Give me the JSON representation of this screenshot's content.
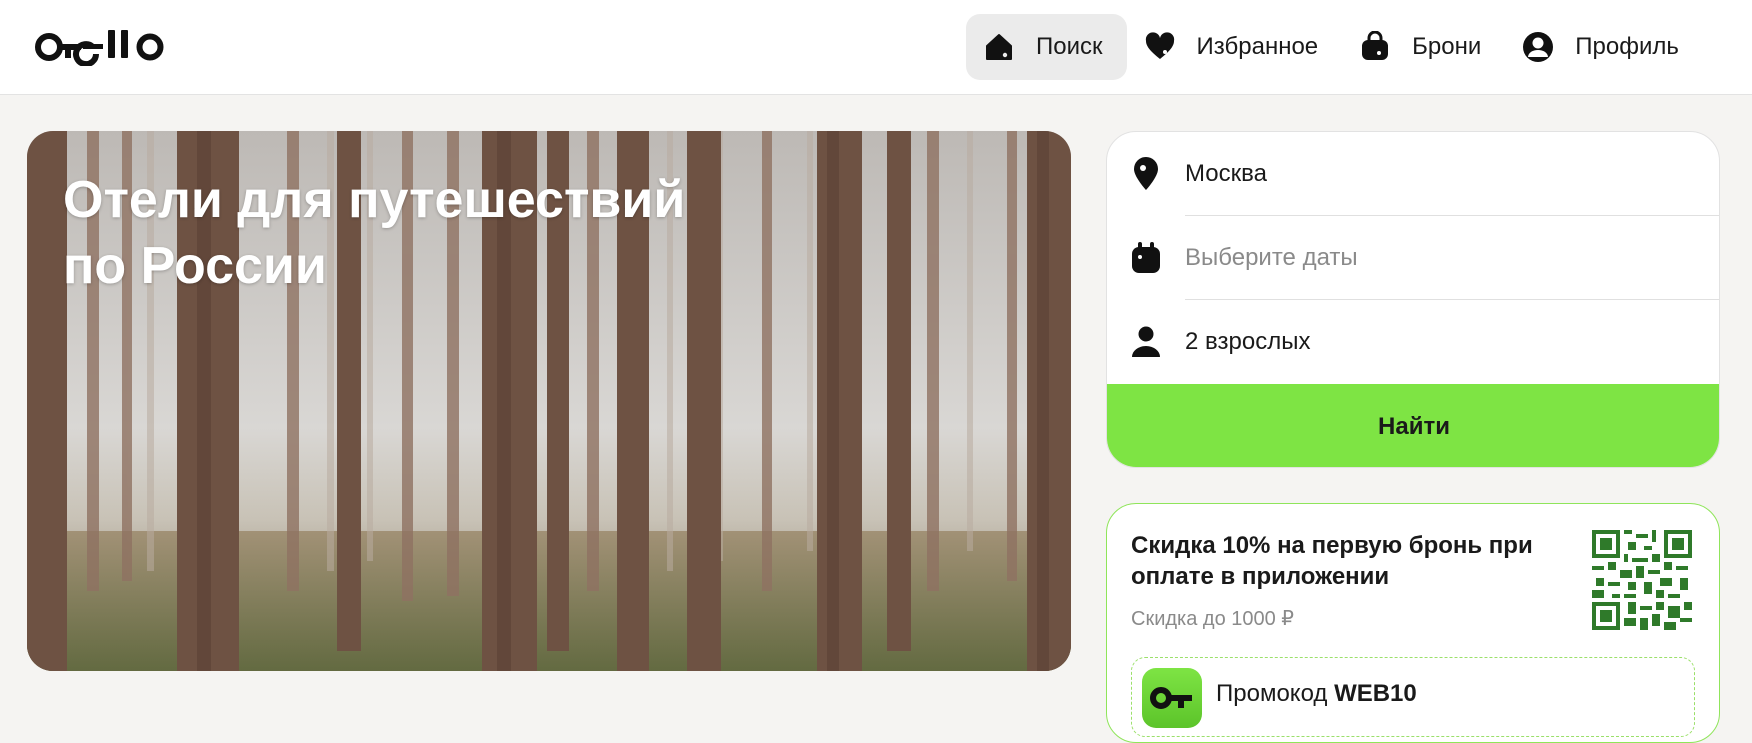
{
  "header": {
    "logo_text": "otello",
    "nav": [
      {
        "label": "Поиск",
        "icon": "home-icon",
        "active": true
      },
      {
        "label": "Избранное",
        "icon": "heart-icon",
        "active": false
      },
      {
        "label": "Брони",
        "icon": "bag-icon",
        "active": false
      },
      {
        "label": "Профиль",
        "icon": "user-icon",
        "active": false
      }
    ]
  },
  "hero": {
    "title_line1": "Отели для путешествий",
    "title_line2": "по России"
  },
  "search": {
    "location": {
      "icon": "location-pin-icon",
      "value": "Москва"
    },
    "dates": {
      "icon": "calendar-icon",
      "placeholder": "Выберите даты"
    },
    "guests": {
      "icon": "person-icon",
      "value": "2 взрослых"
    },
    "submit_label": "Найти"
  },
  "promo": {
    "title": "Скидка 10% на первую бронь при оплате в приложении",
    "subtitle": "Скидка до 1000 ₽",
    "code_label": "Промокод",
    "code_value": "WEB10"
  },
  "colors": {
    "accent_green": "#7ee444",
    "promo_border": "#8fe55a",
    "background": "#f5f4f2",
    "nav_active_bg": "#ebebeb"
  }
}
